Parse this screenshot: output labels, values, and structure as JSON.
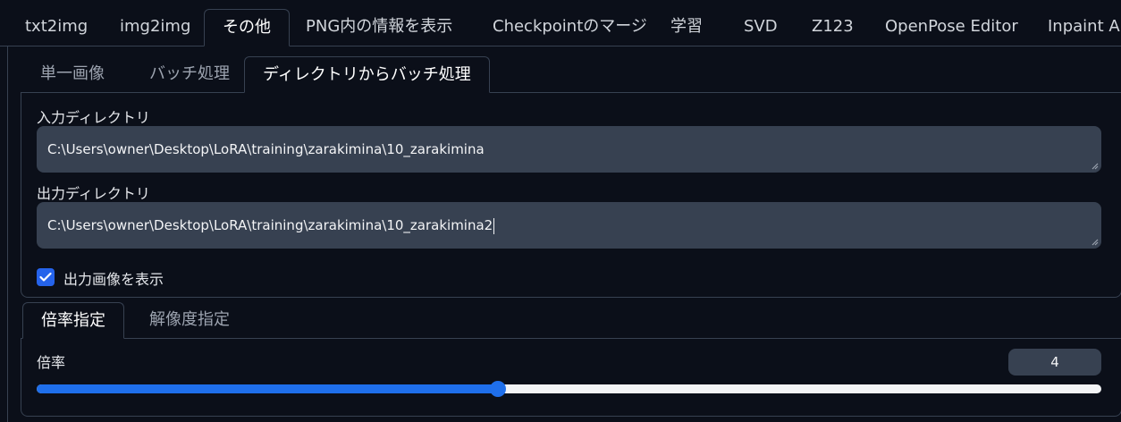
{
  "top_tabs": [
    {
      "label": "txt2img"
    },
    {
      "label": "img2img"
    },
    {
      "label": "その他"
    },
    {
      "label": "PNG内の情報を表示"
    },
    {
      "label": "Checkpointのマージ"
    },
    {
      "label": "学習"
    },
    {
      "label": "SVD"
    },
    {
      "label": "Z123"
    },
    {
      "label": "OpenPose Editor"
    },
    {
      "label": "Inpaint Ar"
    }
  ],
  "active_top_tab": "その他",
  "sub_tabs": [
    {
      "label": "単一画像"
    },
    {
      "label": "バッチ処理"
    },
    {
      "label": "ディレクトリからバッチ処理"
    }
  ],
  "active_sub_tab": "ディレクトリからバッチ処理",
  "input_dir": {
    "label": "入力ディレクトリ",
    "value": "C:\\Users\\owner\\Desktop\\LoRA\\training\\zarakimina\\10_zarakimina"
  },
  "output_dir": {
    "label": "出力ディレクトリ",
    "value": "C:\\Users\\owner\\Desktop\\LoRA\\training\\zarakimina\\10_zarakimina2"
  },
  "show_output": {
    "label": "出力画像を表示",
    "checked": true
  },
  "scale_tabs": [
    {
      "label": "倍率指定"
    },
    {
      "label": "解像度指定"
    }
  ],
  "active_scale_tab": "倍率指定",
  "scale": {
    "label": "倍率",
    "value": "4",
    "fraction": 0.433
  },
  "colors": {
    "background": "#0b0f19",
    "input_bg": "#374151",
    "accent": "#1f6feb",
    "border": "#374151"
  }
}
